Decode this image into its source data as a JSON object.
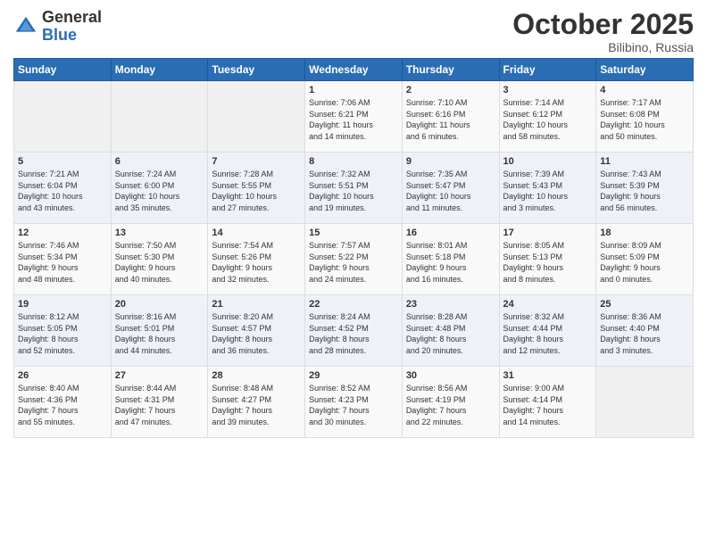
{
  "logo": {
    "general": "General",
    "blue": "Blue"
  },
  "title": "October 2025",
  "location": "Bilibino, Russia",
  "days_of_week": [
    "Sunday",
    "Monday",
    "Tuesday",
    "Wednesday",
    "Thursday",
    "Friday",
    "Saturday"
  ],
  "weeks": [
    [
      {
        "day": "",
        "info": ""
      },
      {
        "day": "",
        "info": ""
      },
      {
        "day": "",
        "info": ""
      },
      {
        "day": "1",
        "info": "Sunrise: 7:06 AM\nSunset: 6:21 PM\nDaylight: 11 hours\nand 14 minutes."
      },
      {
        "day": "2",
        "info": "Sunrise: 7:10 AM\nSunset: 6:16 PM\nDaylight: 11 hours\nand 6 minutes."
      },
      {
        "day": "3",
        "info": "Sunrise: 7:14 AM\nSunset: 6:12 PM\nDaylight: 10 hours\nand 58 minutes."
      },
      {
        "day": "4",
        "info": "Sunrise: 7:17 AM\nSunset: 6:08 PM\nDaylight: 10 hours\nand 50 minutes."
      }
    ],
    [
      {
        "day": "5",
        "info": "Sunrise: 7:21 AM\nSunset: 6:04 PM\nDaylight: 10 hours\nand 43 minutes."
      },
      {
        "day": "6",
        "info": "Sunrise: 7:24 AM\nSunset: 6:00 PM\nDaylight: 10 hours\nand 35 minutes."
      },
      {
        "day": "7",
        "info": "Sunrise: 7:28 AM\nSunset: 5:55 PM\nDaylight: 10 hours\nand 27 minutes."
      },
      {
        "day": "8",
        "info": "Sunrise: 7:32 AM\nSunset: 5:51 PM\nDaylight: 10 hours\nand 19 minutes."
      },
      {
        "day": "9",
        "info": "Sunrise: 7:35 AM\nSunset: 5:47 PM\nDaylight: 10 hours\nand 11 minutes."
      },
      {
        "day": "10",
        "info": "Sunrise: 7:39 AM\nSunset: 5:43 PM\nDaylight: 10 hours\nand 3 minutes."
      },
      {
        "day": "11",
        "info": "Sunrise: 7:43 AM\nSunset: 5:39 PM\nDaylight: 9 hours\nand 56 minutes."
      }
    ],
    [
      {
        "day": "12",
        "info": "Sunrise: 7:46 AM\nSunset: 5:34 PM\nDaylight: 9 hours\nand 48 minutes."
      },
      {
        "day": "13",
        "info": "Sunrise: 7:50 AM\nSunset: 5:30 PM\nDaylight: 9 hours\nand 40 minutes."
      },
      {
        "day": "14",
        "info": "Sunrise: 7:54 AM\nSunset: 5:26 PM\nDaylight: 9 hours\nand 32 minutes."
      },
      {
        "day": "15",
        "info": "Sunrise: 7:57 AM\nSunset: 5:22 PM\nDaylight: 9 hours\nand 24 minutes."
      },
      {
        "day": "16",
        "info": "Sunrise: 8:01 AM\nSunset: 5:18 PM\nDaylight: 9 hours\nand 16 minutes."
      },
      {
        "day": "17",
        "info": "Sunrise: 8:05 AM\nSunset: 5:13 PM\nDaylight: 9 hours\nand 8 minutes."
      },
      {
        "day": "18",
        "info": "Sunrise: 8:09 AM\nSunset: 5:09 PM\nDaylight: 9 hours\nand 0 minutes."
      }
    ],
    [
      {
        "day": "19",
        "info": "Sunrise: 8:12 AM\nSunset: 5:05 PM\nDaylight: 8 hours\nand 52 minutes."
      },
      {
        "day": "20",
        "info": "Sunrise: 8:16 AM\nSunset: 5:01 PM\nDaylight: 8 hours\nand 44 minutes."
      },
      {
        "day": "21",
        "info": "Sunrise: 8:20 AM\nSunset: 4:57 PM\nDaylight: 8 hours\nand 36 minutes."
      },
      {
        "day": "22",
        "info": "Sunrise: 8:24 AM\nSunset: 4:52 PM\nDaylight: 8 hours\nand 28 minutes."
      },
      {
        "day": "23",
        "info": "Sunrise: 8:28 AM\nSunset: 4:48 PM\nDaylight: 8 hours\nand 20 minutes."
      },
      {
        "day": "24",
        "info": "Sunrise: 8:32 AM\nSunset: 4:44 PM\nDaylight: 8 hours\nand 12 minutes."
      },
      {
        "day": "25",
        "info": "Sunrise: 8:36 AM\nSunset: 4:40 PM\nDaylight: 8 hours\nand 3 minutes."
      }
    ],
    [
      {
        "day": "26",
        "info": "Sunrise: 8:40 AM\nSunset: 4:36 PM\nDaylight: 7 hours\nand 55 minutes."
      },
      {
        "day": "27",
        "info": "Sunrise: 8:44 AM\nSunset: 4:31 PM\nDaylight: 7 hours\nand 47 minutes."
      },
      {
        "day": "28",
        "info": "Sunrise: 8:48 AM\nSunset: 4:27 PM\nDaylight: 7 hours\nand 39 minutes."
      },
      {
        "day": "29",
        "info": "Sunrise: 8:52 AM\nSunset: 4:23 PM\nDaylight: 7 hours\nand 30 minutes."
      },
      {
        "day": "30",
        "info": "Sunrise: 8:56 AM\nSunset: 4:19 PM\nDaylight: 7 hours\nand 22 minutes."
      },
      {
        "day": "31",
        "info": "Sunrise: 9:00 AM\nSunset: 4:14 PM\nDaylight: 7 hours\nand 14 minutes."
      },
      {
        "day": "",
        "info": ""
      }
    ]
  ]
}
